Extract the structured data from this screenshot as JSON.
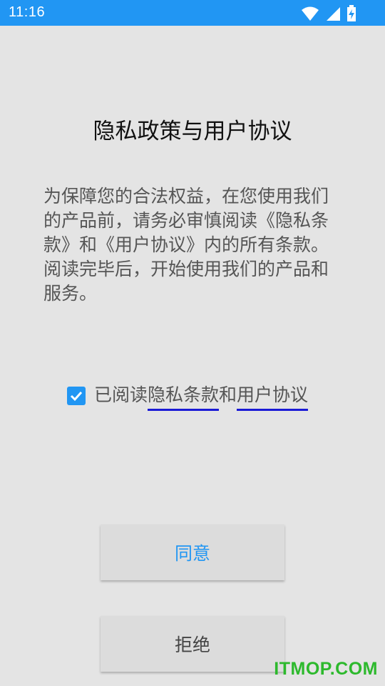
{
  "status_bar": {
    "time": "11:16",
    "icons": [
      "wifi-icon",
      "cell-signal-icon",
      "battery-charging-icon"
    ]
  },
  "dialog": {
    "title": "隐私政策与用户协议",
    "body": "为保障您的合法权益，在您使用我们的产品前，请务必审慎阅读《隐私条款》和《用户协议》内的所有条款。阅读完毕后，开始使用我们的产品和服务。",
    "consent": {
      "checked": true,
      "prefix": "已阅读",
      "privacy_link": "隐私条款",
      "conjunction": "和",
      "agreement_link": "用户协议"
    },
    "agree_label": "同意",
    "refuse_label": "拒绝"
  },
  "watermark": "ITMOP.COM",
  "colors": {
    "accent": "#2196f3",
    "background": "#e4e4e4",
    "link_underline": "#1a1ad6",
    "watermark": "#2db92d"
  }
}
